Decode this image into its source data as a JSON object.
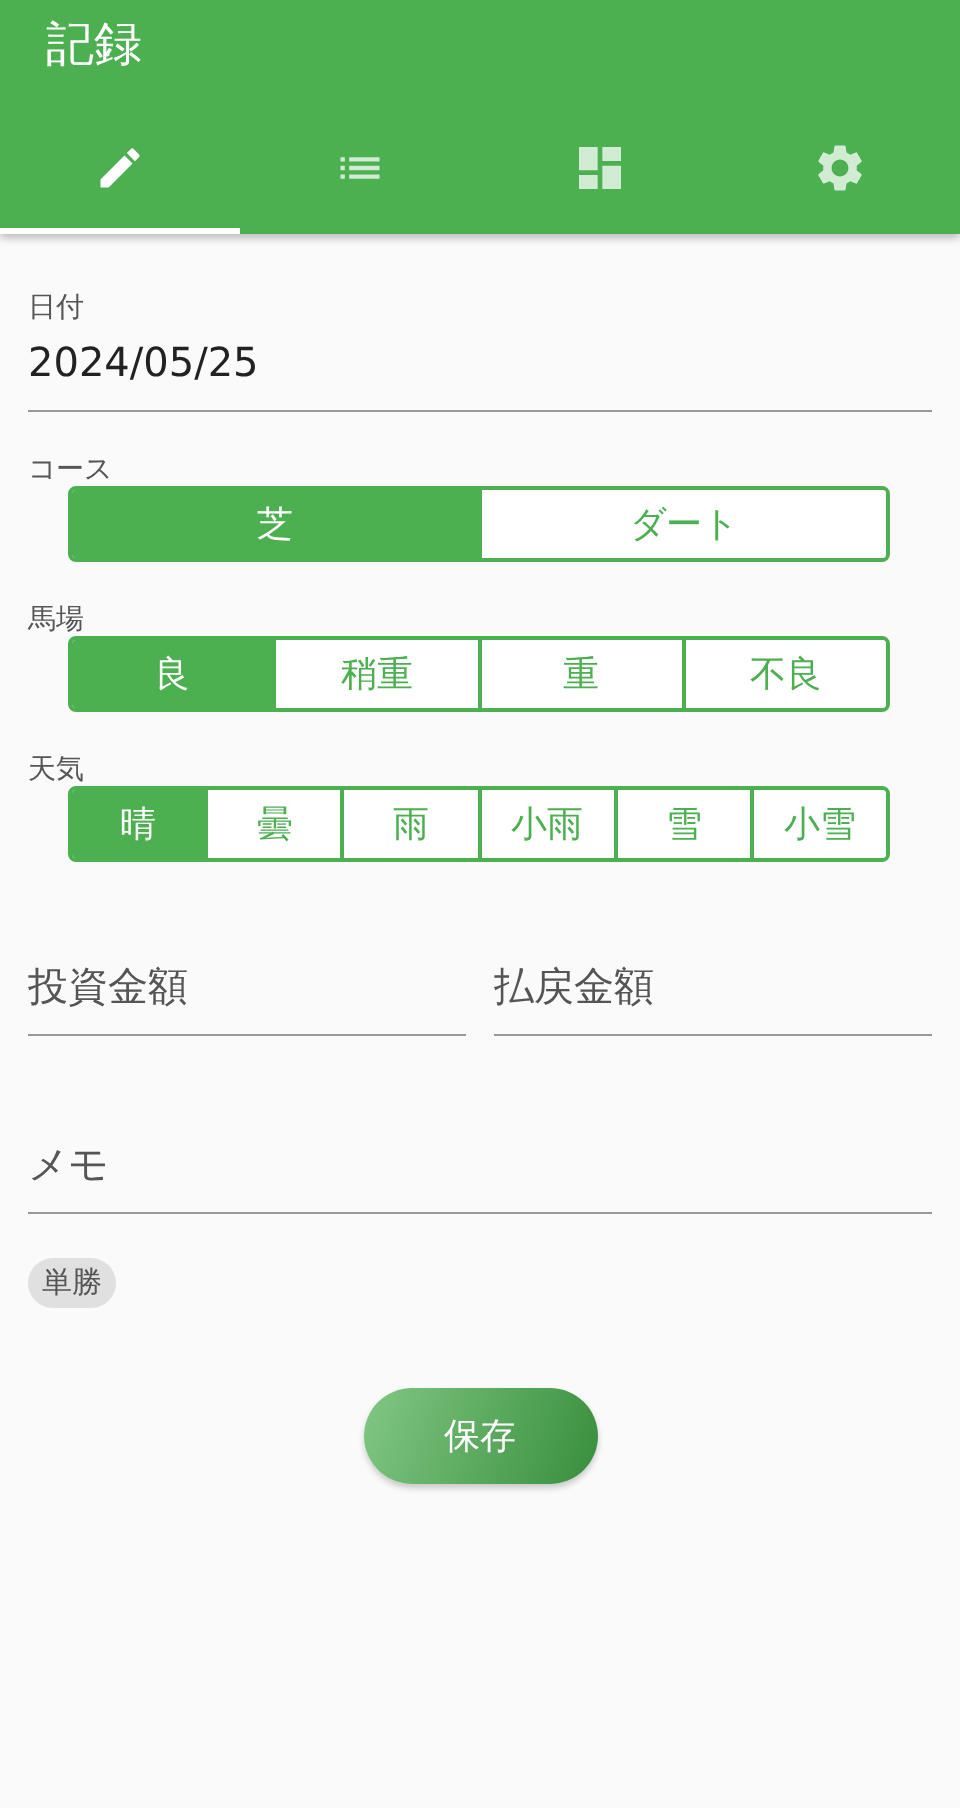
{
  "app_bar": {
    "title": "記録"
  },
  "tabs": [
    {
      "kind": "edit",
      "selected": true
    },
    {
      "kind": "list",
      "selected": false
    },
    {
      "kind": "dashboard",
      "selected": false
    },
    {
      "kind": "settings",
      "selected": false
    }
  ],
  "date_field": {
    "label": "日付",
    "value": "2024/05/25"
  },
  "segments": [
    {
      "label": "コース",
      "options": [
        {
          "label": "芝",
          "selected": true
        },
        {
          "label": "ダート",
          "selected": false
        }
      ]
    },
    {
      "label": "馬場",
      "options": [
        {
          "label": "良",
          "selected": true
        },
        {
          "label": "稍重",
          "selected": false
        },
        {
          "label": "重",
          "selected": false
        },
        {
          "label": "不良",
          "selected": false
        }
      ]
    },
    {
      "label": "天気",
      "options": [
        {
          "label": "晴",
          "selected": true
        },
        {
          "label": "曇",
          "selected": false
        },
        {
          "label": "雨",
          "selected": false
        },
        {
          "label": "小雨",
          "selected": false
        },
        {
          "label": "雪",
          "selected": false
        },
        {
          "label": "小雪",
          "selected": false
        }
      ]
    }
  ],
  "amount_fields": [
    {
      "placeholder": "投資金額"
    },
    {
      "placeholder": "払戻金額"
    }
  ],
  "memo_field": {
    "placeholder": "メモ"
  },
  "chips": [
    {
      "label": "単勝"
    }
  ],
  "save_button": {
    "label": "保存"
  }
}
